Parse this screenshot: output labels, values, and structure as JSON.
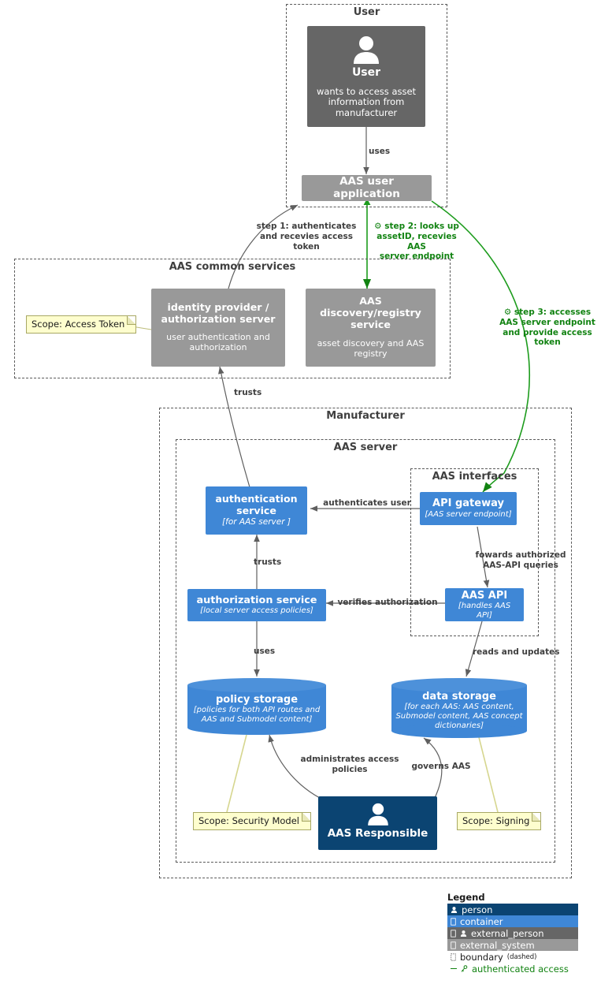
{
  "boundaries": {
    "user": "User",
    "common_services": "AAS common services",
    "manufacturer": "Manufacturer",
    "aas_server": "AAS server",
    "aas_interfaces": "AAS interfaces"
  },
  "nodes": {
    "user": {
      "title": "User",
      "desc": "wants to access asset information from manufacturer",
      "type": "external_person",
      "color": "#666666"
    },
    "aas_user_application": {
      "title": "AAS user application",
      "type": "external_system",
      "color": "#999999"
    },
    "identity_provider": {
      "title": "identity provider / authorization server",
      "desc": "user authentication and authorization",
      "type": "external_system",
      "color": "#999999"
    },
    "discovery_registry": {
      "title": "AAS discovery/registry service",
      "desc": "asset discovery and AAS registry",
      "type": "external_system",
      "color": "#999999"
    },
    "authentication_service": {
      "title": "authentication service",
      "tech": "[for AAS server ]",
      "type": "container",
      "color": "#3f87d6"
    },
    "api_gateway": {
      "title": "API gateway",
      "tech": "[AAS server endpoint]",
      "type": "container",
      "color": "#3f87d6"
    },
    "authorization_service": {
      "title": "authorization service",
      "tech": "[local server access  policies]",
      "type": "container",
      "color": "#3f87d6"
    },
    "aas_api": {
      "title": "AAS API",
      "tech": "[handles AAS API]",
      "type": "container",
      "color": "#3f87d6"
    },
    "policy_storage": {
      "title": "policy storage",
      "tech": "[policies for both API routes and AAS and Submodel content]",
      "type": "database",
      "color": "#3f87d6"
    },
    "data_storage": {
      "title": "data storage",
      "tech": "[for each AAS: AAS content, Submodel content, AAS concept dictionaries]",
      "type": "database",
      "color": "#3f87d6"
    },
    "aas_responsible": {
      "title": "AAS Responsible",
      "type": "person",
      "color": "#0B4472"
    }
  },
  "notes": {
    "access_token": "Scope: Access Token",
    "security_model": "Scope: Security Model",
    "signing": "Scope: Signing"
  },
  "edges": {
    "uses": "uses",
    "step1": "step 1: authenticates\nand recevies access\ntoken",
    "step2": "⚙ step 2: looks up\nassetID, recevies AAS\nserver endpoint",
    "step3": "⚙ step 3: accesses\nAAS server endpoint\nand provide access\ntoken",
    "trusts_idp": "trusts",
    "authenticates_user": "authenticates user",
    "trusts_auth": "trusts",
    "forwards": "fowards authorized\nAAS-API queries",
    "verifies": "verifies authorization",
    "uses_policy": "uses",
    "reads_updates": "reads and updates",
    "administrates": "administrates access\npolicies",
    "governs": "governs AAS"
  },
  "legend": {
    "title": "Legend",
    "items": [
      {
        "label": "person",
        "icon": "person-icon",
        "color": "#0B4472"
      },
      {
        "label": "container",
        "icon": "container-icon",
        "color": "#3f87d6"
      },
      {
        "label": "external_person",
        "icon": "person-icon",
        "color": "#666666"
      },
      {
        "label": "external_system",
        "icon": "container-icon",
        "color": "#999999"
      },
      {
        "label": "boundary",
        "sub": "(dashed)",
        "icon": "boundary-icon",
        "color": "#1a1a1a"
      },
      {
        "label": "authenticated access",
        "icon": "key-icon",
        "color": "#128312"
      }
    ]
  },
  "colors": {
    "person": "#0B4472",
    "container": "#3f87d6",
    "external_person": "#666666",
    "external_system": "#999999",
    "authenticated": "#128312",
    "note_bg": "#FEFECE",
    "boundary_line": "#5a5a5a",
    "edge_line": "#6b6b6b"
  }
}
